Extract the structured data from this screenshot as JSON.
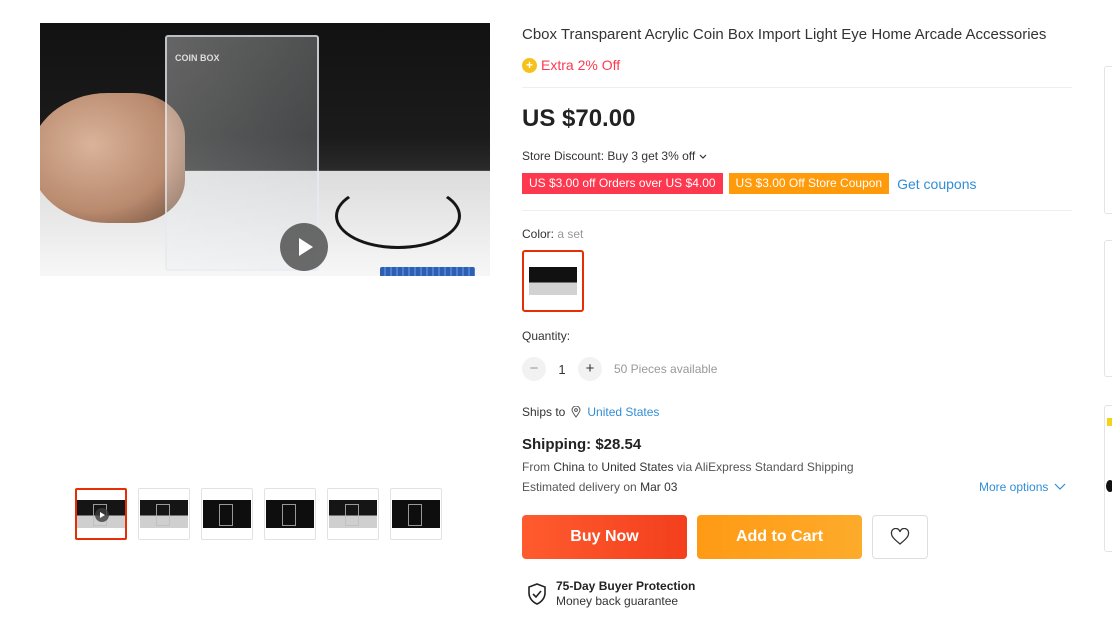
{
  "product": {
    "title": "Cbox Transparent Acrylic Coin Box Import Light Eye Home Arcade Accessories",
    "extra_offer": "Extra 2% Off",
    "price": "US $70.00"
  },
  "gallery": {
    "thumbnails": [
      {
        "label": "thumbnail-1",
        "is_video": true
      },
      {
        "label": "thumbnail-2"
      },
      {
        "label": "thumbnail-3"
      },
      {
        "label": "thumbnail-4"
      },
      {
        "label": "thumbnail-5"
      },
      {
        "label": "thumbnail-6"
      }
    ],
    "main_image_text": "COIN BOX"
  },
  "discount": {
    "store_discount_label": "Store Discount:",
    "store_discount_value": "Buy 3 get 3% off",
    "coupon_1": "US $3.00 off Orders over US $4.00",
    "coupon_2": "US $3.00 Off Store Coupon",
    "get_coupons": "Get coupons"
  },
  "options": {
    "color_label": "Color:",
    "color_value": "a set",
    "quantity_label": "Quantity:",
    "quantity_value": "1",
    "minus": "−",
    "plus": "+",
    "available": "50 Pieces available"
  },
  "shipping": {
    "ships_to_label": "Ships to",
    "country": "United States",
    "shipping_cost": "Shipping: $28.54",
    "from_label": "From",
    "from_country": "China",
    "to_label": "to",
    "to_country": "United States",
    "via": "via AliExpress Standard Shipping",
    "estimated_label": "Estimated delivery on",
    "estimated_date": "Mar 03",
    "more_options": "More options"
  },
  "actions": {
    "buy_now": "Buy Now",
    "add_to_cart": "Add to Cart"
  },
  "protection": {
    "title": "75-Day Buyer Protection",
    "subtitle": "Money back guarantee"
  },
  "colors": {
    "accent_red": "#fd384f",
    "accent_orange": "#ff9a0a",
    "link_blue": "#318ed6",
    "selected_border": "#e62e04"
  },
  "icons": [
    "play-icon",
    "coin-icon",
    "chevron-down-icon",
    "location-pin-icon",
    "heart-icon",
    "shield-check-icon"
  ]
}
